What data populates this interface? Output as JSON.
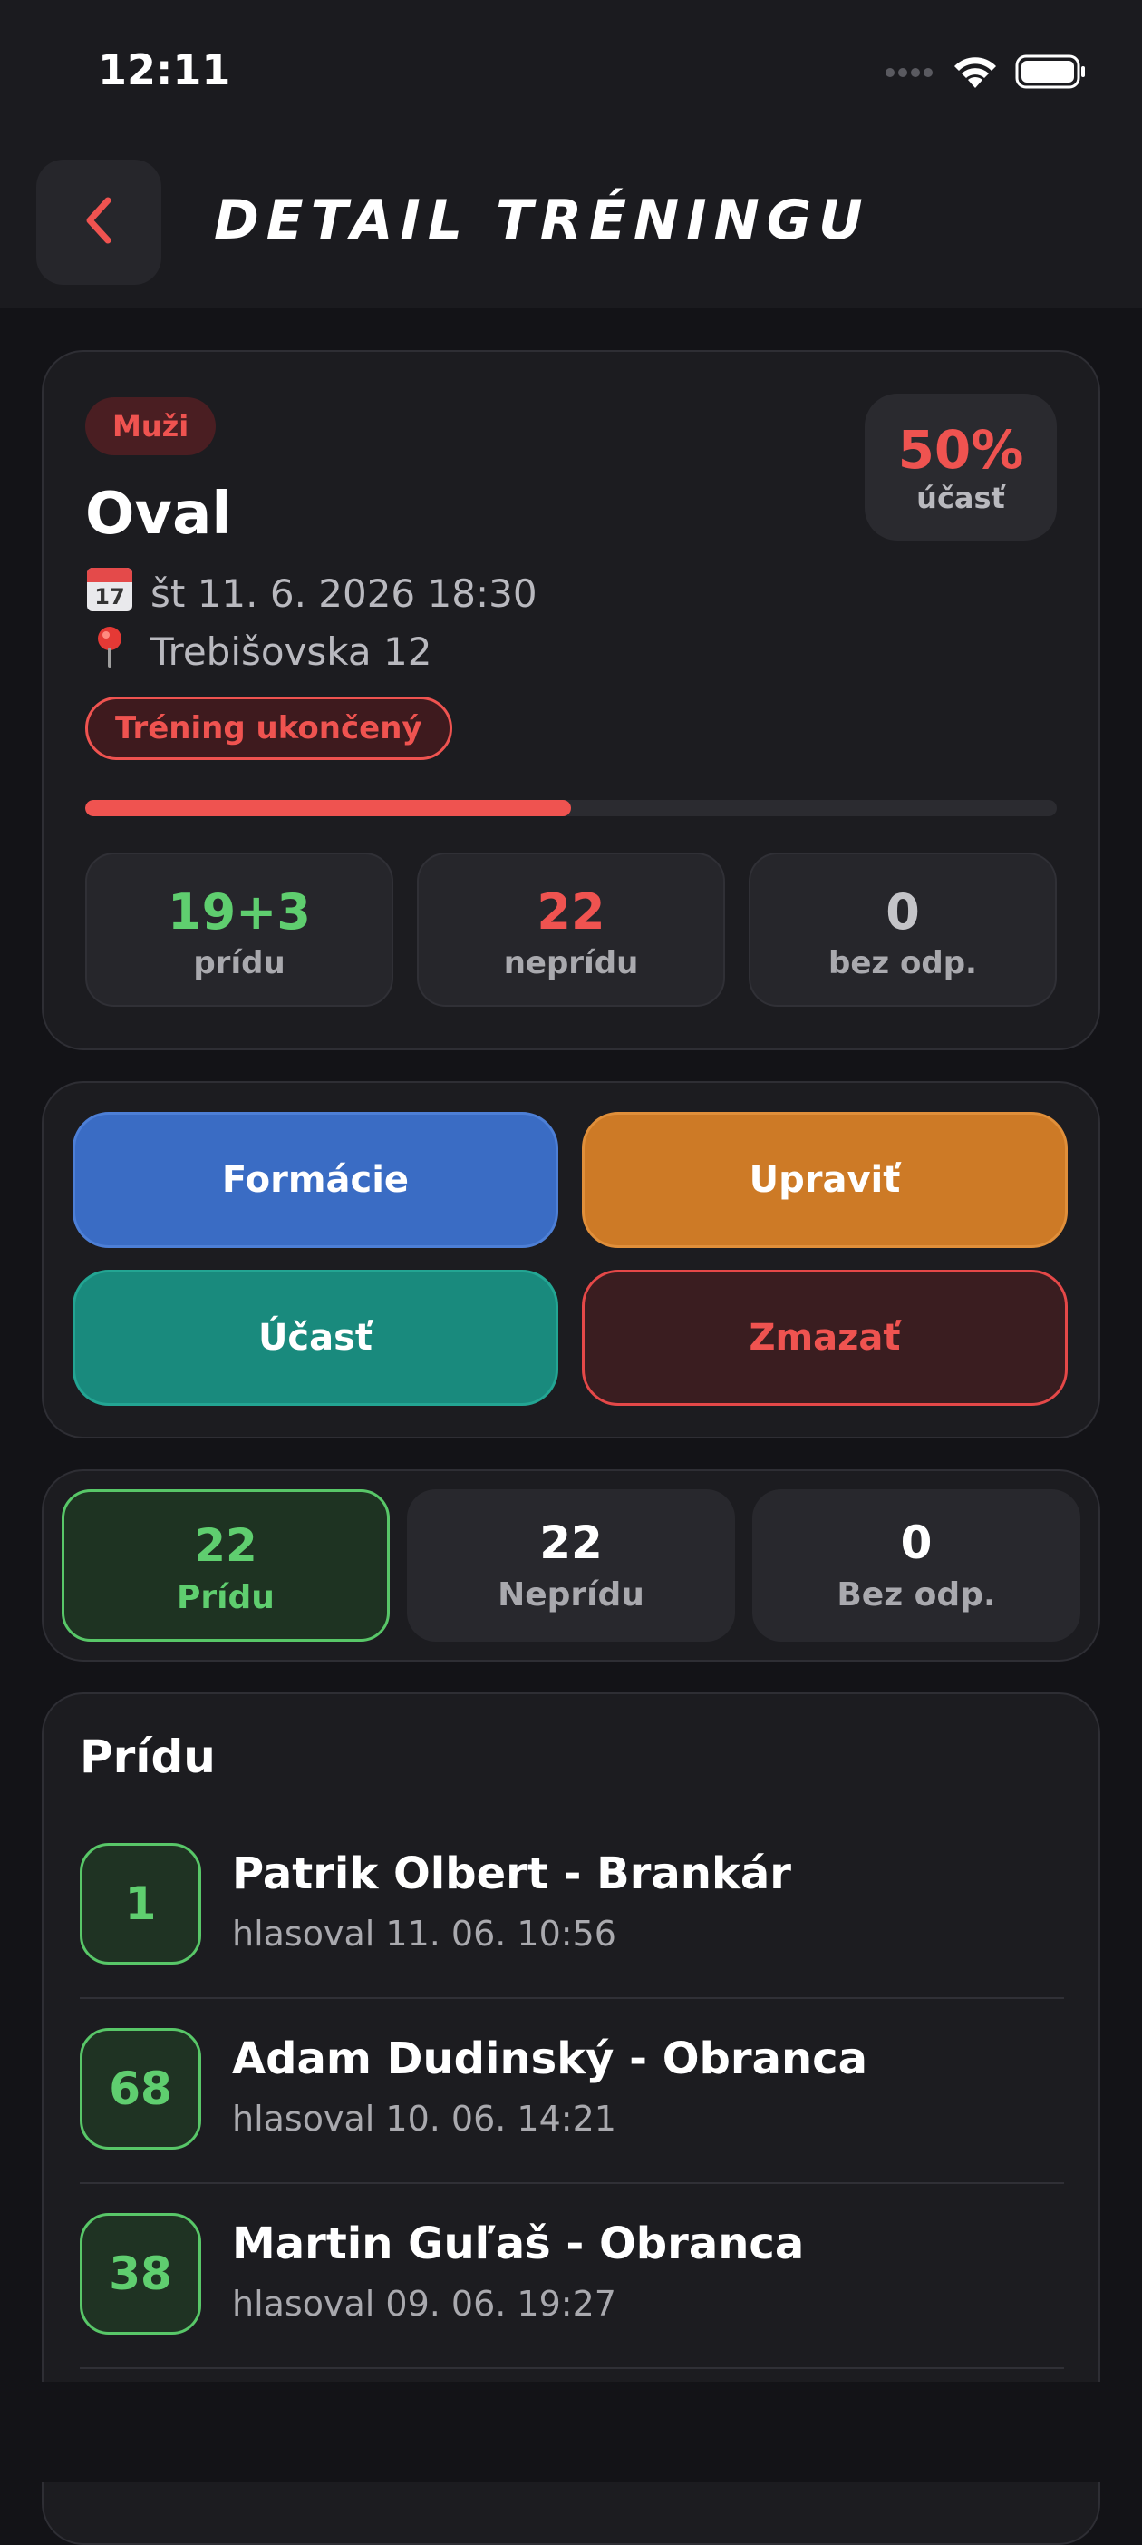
{
  "status_bar": {
    "time": "12:11"
  },
  "header": {
    "title": "DETAIL TRÉNINGU"
  },
  "training": {
    "category": "Muži",
    "name": "Oval",
    "date_icon": "calendar-icon",
    "date": "št 11. 6. 2026 18:30",
    "location_icon": "pin-icon",
    "location": "Trebišovska 12",
    "status": "Tréning ukončený",
    "attendance_pct": "50%",
    "attendance_label": "účasť",
    "progress": 0.5
  },
  "stats": [
    {
      "value": "19+3",
      "label": "prídu",
      "color": "#5fce6f"
    },
    {
      "value": "22",
      "label": "neprídu",
      "color": "#ef5350"
    },
    {
      "value": "0",
      "label": "bez odp.",
      "color": "#c4c4c8"
    }
  ],
  "actions": {
    "formations": "Formácie",
    "edit": "Upraviť",
    "attendance": "Účasť",
    "delete": "Zmazať"
  },
  "tabs": [
    {
      "count": "22",
      "label": "Prídu",
      "active": true
    },
    {
      "count": "22",
      "label": "Neprídu",
      "active": false
    },
    {
      "count": "0",
      "label": "Bez odp.",
      "active": false
    }
  ],
  "list": {
    "title": "Prídu",
    "players": [
      {
        "number": "1",
        "name": "Patrik Olbert - Brankár",
        "voted": "hlasoval 11. 06. 10:56"
      },
      {
        "number": "68",
        "name": "Adam Dudinský - Obranca",
        "voted": "hlasoval 10. 06. 14:21"
      },
      {
        "number": "38",
        "name": "Martin Guľaš - Obranca",
        "voted": "hlasoval 09. 06. 19:27"
      }
    ]
  },
  "colors": {
    "accent_red": "#ef5350",
    "green": "#5fce6f",
    "blue": "#3a6cc4",
    "orange": "#cd7a26",
    "teal": "#198a7d"
  }
}
